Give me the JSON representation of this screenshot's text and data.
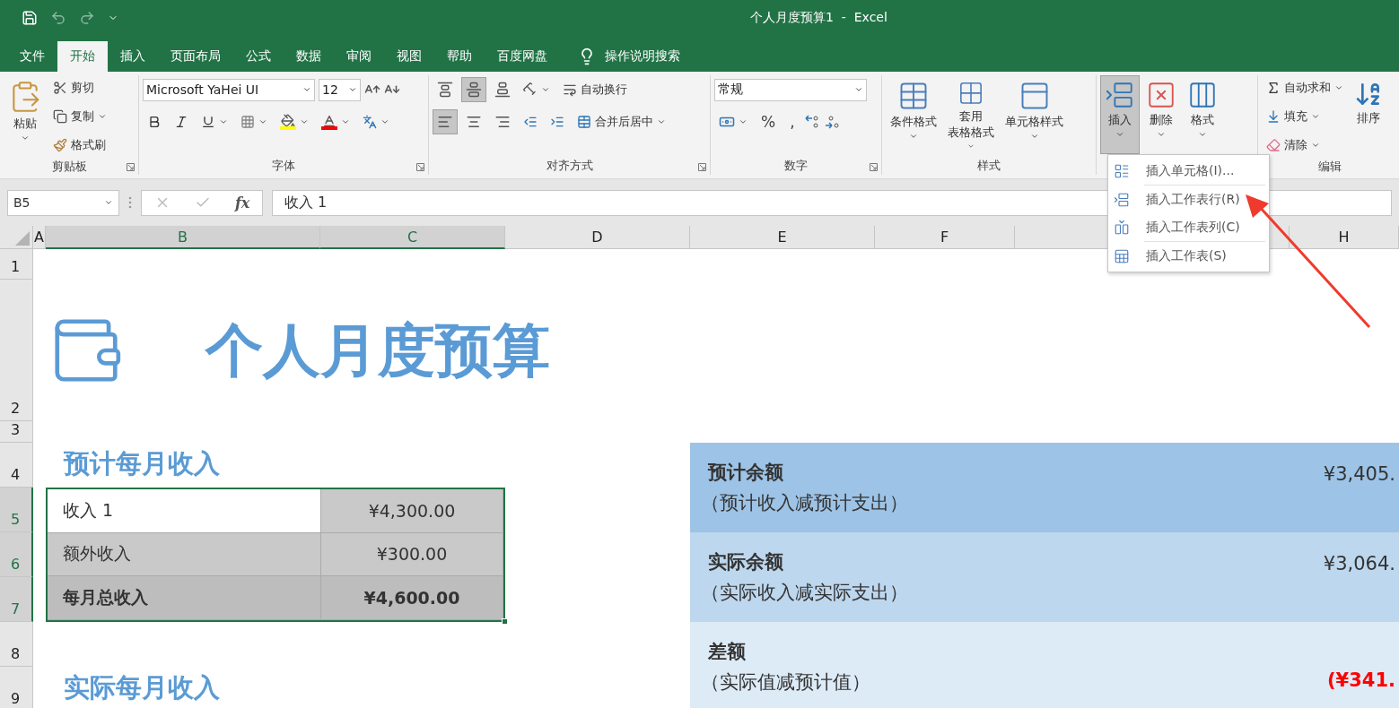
{
  "title_bar": {
    "title": "个人月度预算1  -  Excel"
  },
  "tabs": [
    {
      "label": "文件",
      "selected": false
    },
    {
      "label": "开始",
      "selected": true
    },
    {
      "label": "插入",
      "selected": false
    },
    {
      "label": "页面布局",
      "selected": false
    },
    {
      "label": "公式",
      "selected": false
    },
    {
      "label": "数据",
      "selected": false
    },
    {
      "label": "审阅",
      "selected": false
    },
    {
      "label": "视图",
      "selected": false
    },
    {
      "label": "帮助",
      "selected": false
    },
    {
      "label": "百度网盘",
      "selected": false
    }
  ],
  "tell_me": "操作说明搜索",
  "ribbon": {
    "clipboard": {
      "label": "剪贴板",
      "paste": "粘贴",
      "cut": "剪切",
      "copy": "复制",
      "format_painter": "格式刷"
    },
    "font": {
      "label": "字体",
      "name": "Microsoft YaHei UI",
      "size": "12"
    },
    "alignment": {
      "label": "对齐方式",
      "wrap": "自动换行",
      "merge": "合并后居中",
      "vertical": [
        {
          "kind": "top",
          "selected": false
        },
        {
          "kind": "middle",
          "selected": true
        },
        {
          "kind": "bottom",
          "selected": false
        }
      ],
      "horizontal": [
        {
          "kind": "left",
          "selected": true
        },
        {
          "kind": "center",
          "selected": false
        },
        {
          "kind": "right",
          "selected": false
        }
      ]
    },
    "number": {
      "label": "数字",
      "format": "常规",
      "percent": "%",
      "comma": ","
    },
    "styles": {
      "label": "样式",
      "buttons": [
        {
          "lines": [
            "条件格式"
          ],
          "kind": "conditional"
        },
        {
          "lines": [
            "套用",
            "表格格式"
          ],
          "kind": "table"
        },
        {
          "lines": [
            "单元格样式"
          ],
          "kind": "cell"
        }
      ]
    },
    "cells": {
      "buttons": [
        {
          "label": "插入",
          "kind": "insert",
          "selected": true
        },
        {
          "label": "删除",
          "kind": "delete",
          "selected": false
        },
        {
          "label": "格式",
          "kind": "format",
          "selected": false
        }
      ]
    },
    "editing": {
      "label": "编辑",
      "autosum": "自动求和",
      "fill": "填充",
      "clear": "清除",
      "sort": "排序"
    }
  },
  "formula_bar": {
    "name_box": "B5",
    "function_label": "fx",
    "value": "收入 1"
  },
  "columns": [
    {
      "label": "A",
      "selected": false
    },
    {
      "label": "B",
      "selected": true
    },
    {
      "label": "C",
      "selected": true
    },
    {
      "label": "D",
      "selected": false
    },
    {
      "label": "E",
      "selected": false
    },
    {
      "label": "F",
      "selected": false
    },
    {
      "label": "H",
      "selected": false
    }
  ],
  "rows": [
    {
      "label": "1",
      "selected": false
    },
    {
      "label": "2",
      "selected": false
    },
    {
      "label": "3",
      "selected": false
    },
    {
      "label": "4",
      "selected": false
    },
    {
      "label": "5",
      "selected": true
    },
    {
      "label": "6",
      "selected": true
    },
    {
      "label": "7",
      "selected": true
    },
    {
      "label": "8",
      "selected": false
    },
    {
      "label": "9",
      "selected": false
    }
  ],
  "sheet": {
    "title": "个人月度预算",
    "sections": [
      "预计每月收入",
      "实际每月收入"
    ],
    "income": [
      {
        "label": "收入 1",
        "value": "¥4,300.00",
        "kind": "item",
        "active": true
      },
      {
        "label": "额外收入",
        "value": "¥300.00",
        "kind": "item",
        "active": false
      },
      {
        "label": "每月总收入",
        "value": "¥4,600.00",
        "kind": "total",
        "active": false
      }
    ],
    "summary": [
      {
        "title": "预计余额",
        "note": "（预计收入减预计支出）",
        "value": "¥3,405.",
        "color": "#9dc3e6",
        "negative": false
      },
      {
        "title": "实际余额",
        "note": "（实际收入减实际支出）",
        "value": "¥3,064.",
        "color": "#bdd7ee",
        "negative": false
      },
      {
        "title": "差额",
        "note": "（实际值减预计值）",
        "value": "(¥341.",
        "color": "#ddebf7",
        "negative": true
      }
    ]
  },
  "menu": {
    "items": [
      {
        "label": "插入单元格(I)...",
        "kind": "cells",
        "separator_before": false
      },
      {
        "label": "插入工作表行(R)",
        "kind": "row",
        "separator_before": true
      },
      {
        "label": "插入工作表列(C)",
        "kind": "column",
        "separator_before": false
      },
      {
        "label": "插入工作表(S)",
        "kind": "sheet",
        "separator_before": true
      }
    ]
  }
}
